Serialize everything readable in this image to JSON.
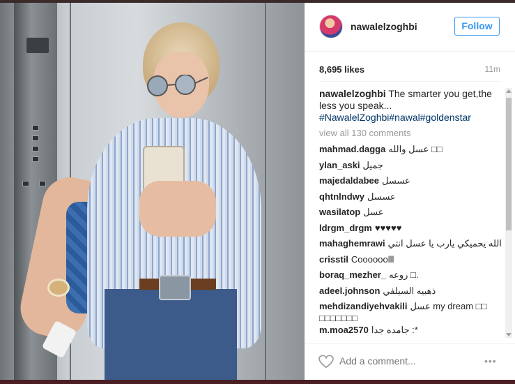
{
  "post": {
    "username": "nawalelzoghbi",
    "follow_label": "Follow",
    "likes": "8,695 likes",
    "time": "11m",
    "caption_user": "nawalelzoghbi",
    "caption_text": "The smarter you get,the less you speak...",
    "caption_tags": "#NawalelZoghbi#nawal#goldenstar",
    "view_all": "view all 130 comments"
  },
  "comments": [
    {
      "user": "mahmad.dagga",
      "text": "عسل والله □□"
    },
    {
      "user": "ylan_aski",
      "text": "جميل"
    },
    {
      "user": "majedaldabee",
      "text": "عسسل"
    },
    {
      "user": "qhtnlndwy",
      "text": "عسسل"
    },
    {
      "user": "wasilatop",
      "text": "عسل"
    },
    {
      "user": "ldrgm_drgm",
      "text": "♥♥♥♥♥"
    },
    {
      "user": "mahaghemrawi",
      "text": "الله يحميكي يارب يا عسل انتي"
    },
    {
      "user": "crisstil",
      "text": "Coooooolll"
    },
    {
      "user": "boraq_mezher_",
      "text": "روعه □."
    },
    {
      "user": "adeel.johnson",
      "text": "ذهبيه السيلفي"
    },
    {
      "user": "mehdizandiyehvakili",
      "text": "عسل my dream □□ □□□□□□□"
    },
    {
      "user": "m.moa2570",
      "text": "جامده جدا :*"
    }
  ],
  "footer": {
    "placeholder": "Add a comment...",
    "more": "•••"
  },
  "icons": {
    "like": "heart-icon",
    "more": "more-options-icon"
  },
  "colors": {
    "link": "#003569",
    "follow": "#3897f0",
    "text": "#262626",
    "muted": "#999999"
  }
}
